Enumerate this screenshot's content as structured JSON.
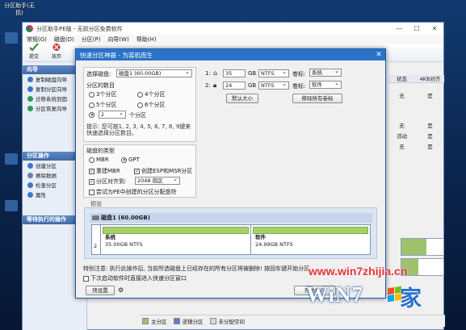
{
  "desktop": {
    "icon_label": "分区助手(无损)"
  },
  "app": {
    "title": "分区助手PE版 - 无损分区免费软件",
    "menu": [
      "常规(G)",
      "磁盘(D)",
      "分区(P)",
      "向导(W)",
      "帮助(H)"
    ],
    "toolbar": [
      "提交",
      "放弃"
    ],
    "sections": {
      "wizard_title": "向导",
      "wizard_items": [
        "复制磁盘向导",
        "复制分区向导",
        "迁移系统到固",
        "分区恢复向导"
      ],
      "ops_title": "分区操作",
      "ops_items": [
        "创建分区",
        "擦除数据",
        "检查分区",
        "属性"
      ],
      "pending_title": "等待执行的操作"
    },
    "columns": [
      "状态",
      "4KB对齐"
    ],
    "rows": [
      [
        "无",
        "是"
      ],
      [
        "无",
        "是"
      ],
      [
        "活动",
        "是"
      ],
      [
        "无",
        "是"
      ]
    ],
    "legend": [
      "主分区",
      "逻辑分区",
      "未分配空间"
    ]
  },
  "dialog": {
    "title": "快速分区神器 - 为装机而生",
    "disk_label": "选择磁盘:",
    "disk_value": "磁盘1 (60.00GB)",
    "count_label": "分区的数目",
    "count_opts": [
      "3个分区",
      "4个分区",
      "5个分区",
      "6个分区"
    ],
    "custom_count": "2",
    "custom_suffix": "个分区",
    "hint": "提示: 您可按1, 2, 3, 4, 5, 6, 7, 8, 9键来快速选择分区数目。",
    "type_label": "磁盘的类型",
    "type_opts": [
      "MBR",
      "GPT"
    ],
    "rebuild_mbr": "重建MBR",
    "create_esp": "创建ESP和MSR分区",
    "align_label": "分区对齐到:",
    "align_value": "2048 扇区",
    "pe_recovery": "尝试为PE中创建的分区分配盘符",
    "partitions": [
      {
        "num": "1:",
        "size": "35",
        "unit": "GB",
        "fs": "NTFS",
        "vlabel_name": "卷标:",
        "vlabel": "系统"
      },
      {
        "num": "2:",
        "size": "24",
        "unit": "GB",
        "fs": "NTFS",
        "vlabel_name": "卷标:",
        "vlabel": "软件"
      }
    ],
    "default_size_btn": "默认大小",
    "clear_labels_btn": "移除所有卷标",
    "preview_label": "预览",
    "preview_disk": "磁盘1 (60.00GB)",
    "preview_num": "2",
    "preview_parts": [
      {
        "name": "系统",
        "info": "35.00GB NTFS"
      },
      {
        "name": "软件",
        "info": "24.99GB NTFS"
      }
    ],
    "notice": "特别注意: 执行此操作后, 当前所选磁盘上已经存在的所有分区将被删除! 按回车键开始分区",
    "next_boot": "下次启动软件时直接进入快速分区窗口",
    "reset_btn": "快设置",
    "start_btn": "开始执行"
  },
  "watermark": {
    "url": "www.win7zhijia.cn",
    "logo": "WiN7",
    "suffix": "家"
  }
}
